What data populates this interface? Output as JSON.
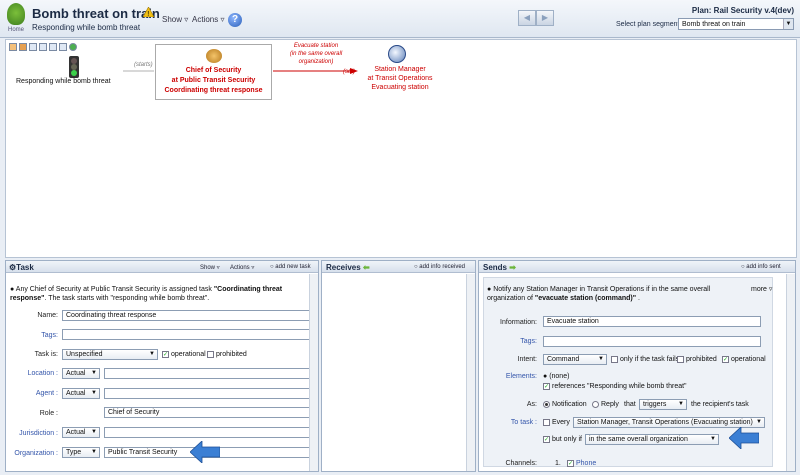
{
  "header": {
    "home_label": "Home",
    "title": "Bomb threat on train",
    "subtitle": "Responding while bomb threat",
    "show": "Show",
    "actions": "Actions",
    "help": "?",
    "plan": "Plan: Rail Security v.4(dev)",
    "segment_label": "Select plan segment:",
    "segment_value": "Bomb threat on train"
  },
  "canvas": {
    "event_label": "Responding while bomb threat",
    "starts": "(starts)",
    "chief_lines": [
      "Chief of Security",
      "at Public Transit Security",
      "Coordinating threat response"
    ],
    "flow_label_lines": [
      "Evacuate station",
      "(in the same overall",
      "organization)"
    ],
    "satisfies": "(sat)",
    "sm_lines": [
      "Station Manager",
      "at Transit Operations",
      "Evacuating station"
    ]
  },
  "task": {
    "title": "Task",
    "show": "Show",
    "actions": "Actions",
    "add_new": "add new task",
    "summary_pre": "Any Chief of Security at Public Transit Security is assigned task ",
    "summary_task": "\"Coordinating threat response\"",
    "summary_post": ". The task starts with \"responding while bomb threat\".",
    "name_label": "Name:",
    "name_value": "Coordinating threat response",
    "tags_label": "Tags:",
    "task_is_label": "Task is:",
    "task_is_value": "Unspecified",
    "operational": "operational",
    "prohibited": "prohibited",
    "location_label": "Location :",
    "location_sel": "Actual",
    "agent_label": "Agent :",
    "agent_sel": "Actual",
    "role_label": "Role :",
    "role_value": "Chief of Security",
    "jurisdiction_label": "Jurisdiction :",
    "jurisdiction_sel": "Actual",
    "organization_label": "Organization :",
    "organization_sel": "Type",
    "organization_value": "Public Transit Security"
  },
  "receives": {
    "title": "Receives",
    "add": "add info received"
  },
  "sends": {
    "title": "Sends",
    "add": "add info sent",
    "summary_pre": "Notify any Station Manager in Transit Operations if in the same overall organization of ",
    "summary_bold": "\"evacuate station (command)\"",
    "summary_post": " .",
    "more": "more",
    "information_label": "Information:",
    "information_value": "Evacuate station",
    "tags_label": "Tags:",
    "intent_label": "Intent:",
    "intent_value": "Command",
    "only_if_fails": "only if the task fails",
    "prohibited": "prohibited",
    "operational": "operational",
    "elements_label": "Elements:",
    "elements_none": "(none)",
    "references": "references \"Responding while bomb threat\"",
    "as_label": "As:",
    "notification": "Notification",
    "reply": "Reply",
    "that": "that",
    "triggers": "triggers",
    "recipient": "the recipient's task",
    "to_task_label": "To task :",
    "every": "Every",
    "to_task_value": "Station Manager, Transit Operations (Evacuating station)",
    "but_only_if": "but only if",
    "condition": "in the same overall organization",
    "channels_label": "Channels:",
    "channel_num": "1.",
    "channel_value": "Phone"
  },
  "colors": {
    "accent_red": "#cc0000",
    "link_blue": "#3355aa",
    "arrow_blue": "#3b7fd4"
  }
}
